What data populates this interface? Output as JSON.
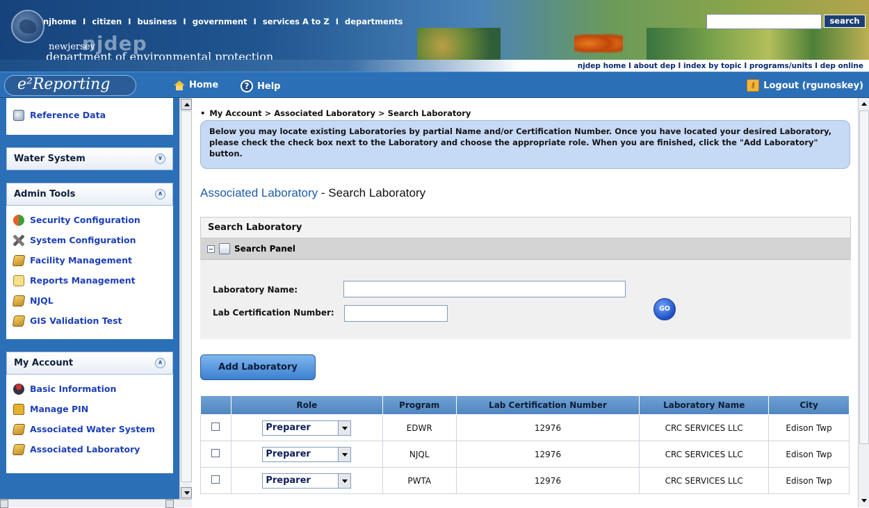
{
  "banner": {
    "top_links": [
      "njhome",
      "citizen",
      "business",
      "government",
      "services A to Z",
      "departments"
    ],
    "separator": "I",
    "search_button": "search",
    "logo_small": "newjersey",
    "logo_big": "njdep",
    "department": "department of environmental protection",
    "sub_links": [
      "njdep home",
      "about dep",
      "index by topic",
      "programs/units",
      "dep online"
    ]
  },
  "navbar": {
    "brand": "e²Reporting",
    "home": "Home",
    "help": "Help",
    "logout": "Logout (rgunoskey)"
  },
  "sidebar": {
    "ref_item": "Reference Data",
    "water_system": "Water System",
    "admin_tools": {
      "title": "Admin Tools",
      "items": [
        "Security Configuration",
        "System Configuration",
        "Facility Management",
        "Reports Management",
        "NJQL",
        "GIS Validation Test"
      ]
    },
    "my_account": {
      "title": "My Account",
      "items": [
        "Basic Information",
        "Manage PIN",
        "Associated Water System",
        "Associated Laboratory"
      ]
    }
  },
  "main": {
    "breadcrumb": "My Account > Associated Laboratory > Search Laboratory",
    "info": "Below you may locate existing Laboratories by partial Name and/or Certification Number. Once you have located your desired Laboratory, please check the check box next to the Laboratory and choose the appropriate role. When you are finished, click the \"Add Laboratory\" button.",
    "heading_link": "Associated Laboratory",
    "heading_rest": " - Search Laboratory",
    "search_title": "Search Laboratory",
    "search_panel": "Search Panel",
    "lab_name_label": "Laboratory Name:",
    "lab_name_value": "",
    "lab_cert_label": "Lab Certification Number:",
    "lab_cert_value": "",
    "go": "GO",
    "add_button": "Add Laboratory",
    "table": {
      "headers": [
        "",
        "Role",
        "Program",
        "Lab Certification Number",
        "Laboratory Name",
        "City"
      ],
      "rows": [
        {
          "role": "Preparer",
          "program": "EDWR",
          "cert": "12976",
          "name": "CRC SERVICES LLC",
          "city": "Edison Twp"
        },
        {
          "role": "Preparer",
          "program": "NJQL",
          "cert": "12976",
          "name": "CRC SERVICES LLC",
          "city": "Edison Twp"
        },
        {
          "role": "Preparer",
          "program": "PWTA",
          "cert": "12976",
          "name": "CRC SERVICES LLC",
          "city": "Edison Twp"
        }
      ]
    }
  }
}
